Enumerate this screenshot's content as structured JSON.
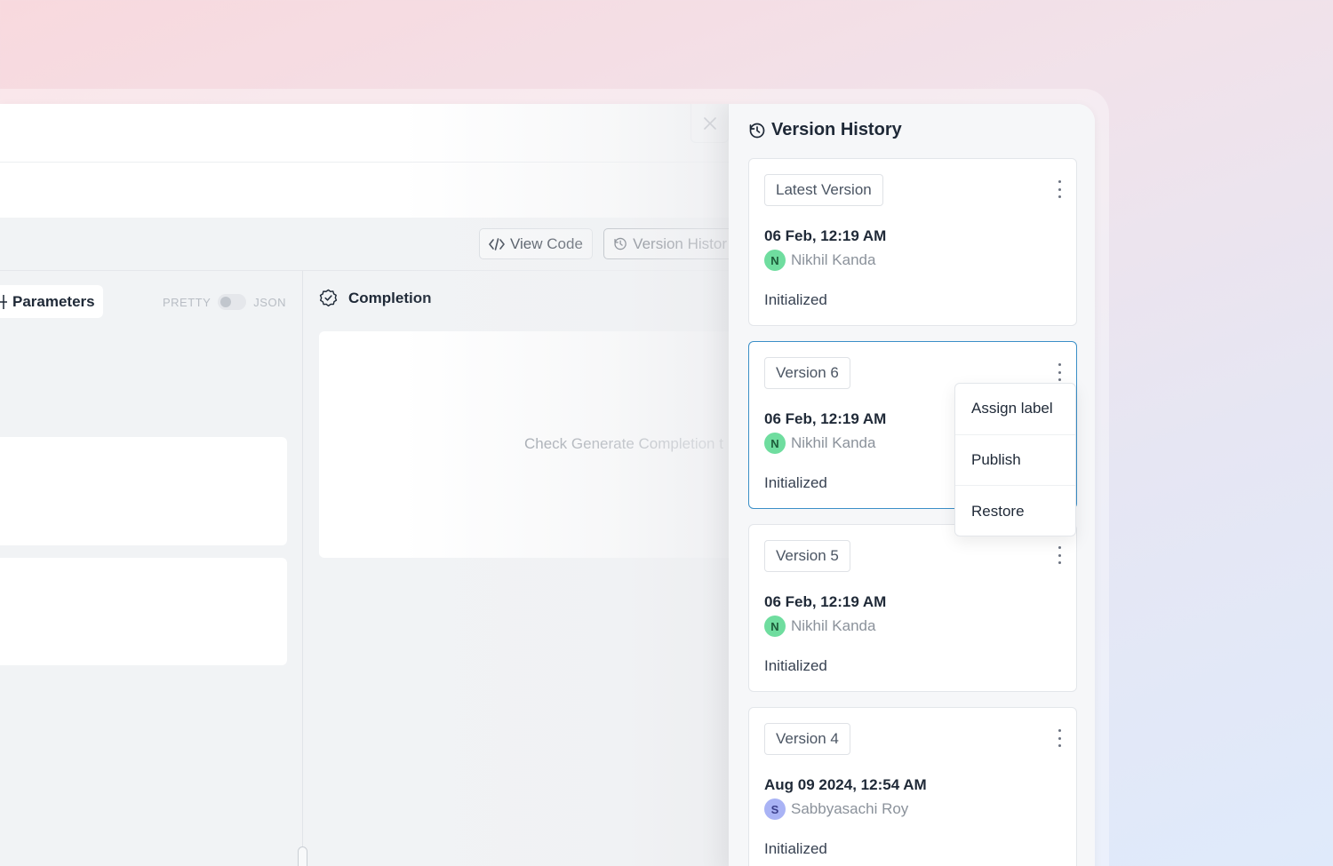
{
  "toolbar": {
    "view_code_label": "View Code",
    "version_history_label": "Version Histor"
  },
  "parameters": {
    "tab_label": "Parameters",
    "toggle_left": "PRETTY",
    "toggle_right": "JSON"
  },
  "completion": {
    "title": "Completion",
    "hint": "Check Generate Completion t"
  },
  "history": {
    "title": "Version History",
    "versions": [
      {
        "label": "Latest Version",
        "date": "06 Feb, 12:19 AM",
        "author": "Nikhil Kanda",
        "initial": "N",
        "note": "Initialized"
      },
      {
        "label": "Version 6",
        "date": "06 Feb, 12:19 AM",
        "author": "Nikhil Kanda",
        "initial": "N",
        "note": "Initialized"
      },
      {
        "label": "Version 5",
        "date": "06 Feb, 12:19 AM",
        "author": "Nikhil Kanda",
        "initial": "N",
        "note": "Initialized"
      },
      {
        "label": "Version 4",
        "date": "Aug 09 2024, 12:54 AM",
        "author": "Sabbyasachi Roy",
        "initial": "S",
        "note": "Initialized"
      }
    ]
  },
  "menu": {
    "items": [
      "Assign label",
      "Publish",
      "Restore"
    ]
  },
  "colors": {
    "accent_border": "#3b8fc7",
    "avatar_green": "#6fdd9f",
    "avatar_purple": "#a9b3f5"
  },
  "icons": {
    "close": "close-icon",
    "code": "code-icon",
    "history": "history-icon",
    "completion": "completion-badge-icon",
    "kebab": "kebab-menu-icon"
  }
}
